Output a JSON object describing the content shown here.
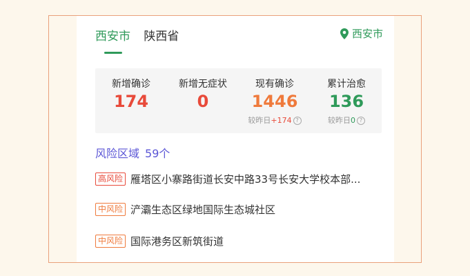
{
  "tabs": {
    "city": "西安市",
    "province": "陕西省"
  },
  "location": {
    "label": "西安市"
  },
  "stats": [
    {
      "label": "新增确诊",
      "value": "174",
      "color": "#e84a3a"
    },
    {
      "label": "新增无症状",
      "value": "0",
      "color": "#e84a3a"
    },
    {
      "label": "现有确诊",
      "value": "1446",
      "color": "#ef7a3c",
      "delta_prefix": "较昨日",
      "delta_value": "+174"
    },
    {
      "label": "累计治愈",
      "value": "136",
      "color": "#2f9a5a",
      "delta_prefix": "较昨日",
      "delta_value": "0"
    }
  ],
  "risk": {
    "title": "风险区域",
    "count": "59个",
    "items": [
      {
        "level": "高风险",
        "text": "雁塔区小寨路街道长安中路33号长安大学校本部..."
      },
      {
        "level": "中风险",
        "text": "浐灞生态区绿地国际生态城社区"
      },
      {
        "level": "中风险",
        "text": "国际港务区新筑街道"
      }
    ]
  }
}
